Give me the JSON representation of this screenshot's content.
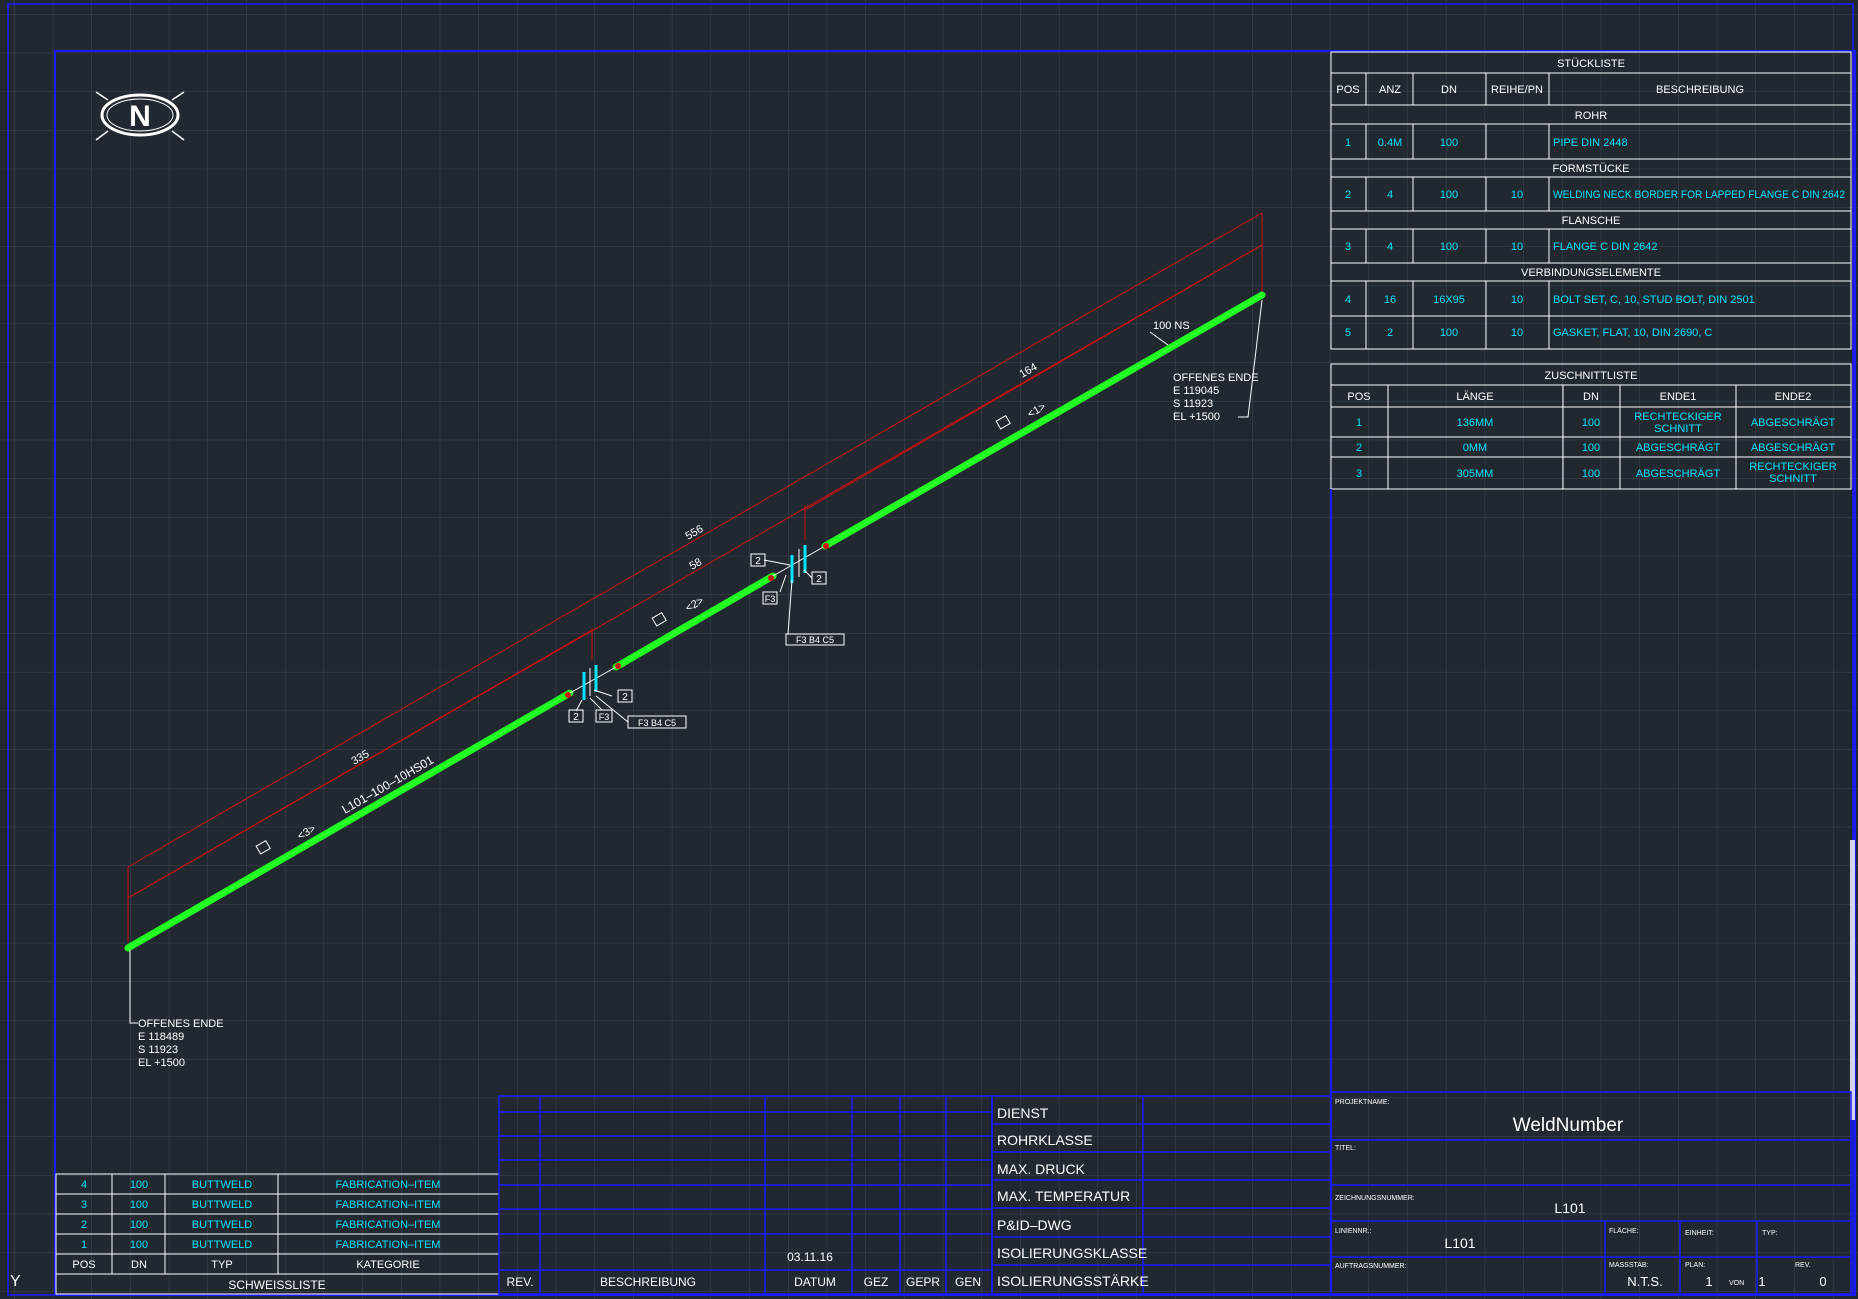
{
  "colors": {
    "background": "#212830",
    "grid": "#3a4654",
    "frame": "#1a1aff",
    "pipe": "#22ff22",
    "dimension": "#cc1111",
    "cyan": "#00e5ff",
    "text": "#ffffff"
  },
  "north_arrow": {
    "letter": "N",
    "icon": "north-arrow-icon"
  },
  "axis_indicator": "Y",
  "stueckliste": {
    "title": "STÜCKLISTE",
    "headers": [
      "POS",
      "ANZ",
      "DN",
      "REIHE/PN",
      "BESCHREIBUNG"
    ],
    "groups": [
      {
        "name": "ROHR",
        "items": [
          {
            "pos": "1",
            "anz": "0.4M",
            "dn": "100",
            "pn": "",
            "desc": "PIPE  DIN  2448"
          }
        ]
      },
      {
        "name": "FORMSTÜCKE",
        "items": [
          {
            "pos": "2",
            "anz": "4",
            "dn": "100",
            "pn": "10",
            "desc": "WELDING  NECK  BORDER  FOR  LAPPED  FLANGE  C  DIN  2642"
          }
        ]
      },
      {
        "name": "FLANSCHE",
        "items": [
          {
            "pos": "3",
            "anz": "4",
            "dn": "100",
            "pn": "10",
            "desc": "FLANGE  C  DIN  2642"
          }
        ]
      },
      {
        "name": "VERBINDUNGSELEMENTE",
        "items": [
          {
            "pos": "4",
            "anz": "16",
            "dn": "16X95",
            "pn": "10",
            "desc": "BOLT  SET,  C,  10,  STUD  BOLT,  DIN  2501"
          },
          {
            "pos": "5",
            "anz": "2",
            "dn": "100",
            "pn": "10",
            "desc": "GASKET,  FLAT,  10,  DIN  2690,  C"
          }
        ]
      }
    ]
  },
  "zuschnittliste": {
    "title": "ZUSCHNITTLISTE",
    "headers": [
      "POS",
      "LÄNGE",
      "DN",
      "ENDE1",
      "ENDE2"
    ],
    "rows": [
      {
        "pos": "1",
        "laenge": "136MM",
        "dn": "100",
        "ende1": [
          "RECHTECKIGER",
          "SCHNITT"
        ],
        "ende2": [
          "ABGESCHRÄGT"
        ]
      },
      {
        "pos": "2",
        "laenge": "0MM",
        "dn": "100",
        "ende1": [
          "ABGESCHRÄGT"
        ],
        "ende2": [
          "ABGESCHRÄGT"
        ]
      },
      {
        "pos": "3",
        "laenge": "305MM",
        "dn": "100",
        "ende1": [
          "ABGESCHRÄGT"
        ],
        "ende2": [
          "RECHTECKIGER",
          "SCHNITT"
        ]
      }
    ]
  },
  "schweissliste": {
    "title": "SCHWEISSLISTE",
    "headers": [
      "POS",
      "DN",
      "TYP",
      "KATEGORIE"
    ],
    "rows": [
      {
        "pos": "4",
        "dn": "100",
        "typ": "BUTTWELD",
        "kat": "FABRICATION–ITEM"
      },
      {
        "pos": "3",
        "dn": "100",
        "typ": "BUTTWELD",
        "kat": "FABRICATION–ITEM"
      },
      {
        "pos": "2",
        "dn": "100",
        "typ": "BUTTWELD",
        "kat": "FABRICATION–ITEM"
      },
      {
        "pos": "1",
        "dn": "100",
        "typ": "BUTTWELD",
        "kat": "FABRICATION–ITEM"
      }
    ]
  },
  "revision_block": {
    "date": "03.11.16",
    "headers": [
      "REV.",
      "BESCHREIBUNG",
      "DATUM",
      "GEZ",
      "GEPR",
      "GEN"
    ]
  },
  "properties": [
    "DIENST",
    "ROHRKLASSE",
    "MAX. DRUCK",
    "MAX. TEMPERATUR",
    "P&ID–DWG",
    "ISOLIERUNGSKLASSE",
    "ISOLIERUNGSSTÄRKE"
  ],
  "title_block": {
    "projektname_label": "PROJEKTNAME:",
    "projektname": "WeldNumber",
    "titel_label": "TITEL:",
    "zeichnungsnummer_label": "ZEICHNUNGSNUMMER:",
    "zeichnungsnummer": "L101",
    "liniennr_label": "LINIENNR.:",
    "liniennr": "L101",
    "flaeche_label": "FLÄCHE:",
    "einheit_label": "EINHEIT:",
    "typ_label": "TYP:",
    "auftragsnummer_label": "AUFTRAGSNUMMER:",
    "massstab_label": "MASSSTAB:",
    "massstab": "N.T.S.",
    "plan_label": "PLAN:",
    "plan": "1",
    "von_label": "VON",
    "von": "1",
    "rev_label": "REV.",
    "rev": "0"
  },
  "drawing": {
    "end1": [
      "OFFENES ENDE",
      "E  118489",
      "S  11923",
      "EL  +1500"
    ],
    "end2": [
      "OFFENES ENDE",
      "E  119045",
      "S  11923",
      "EL  +1500"
    ],
    "pipe_size": "100  NS",
    "line_label": "L101–100–10HS01",
    "dims": [
      "556",
      "58",
      "164",
      "335"
    ],
    "segments": [
      "<3>",
      "<2>",
      "<1>"
    ],
    "tags": {
      "two": "2",
      "f3": "F3",
      "flange_tag": "F3  B4  C5"
    }
  }
}
